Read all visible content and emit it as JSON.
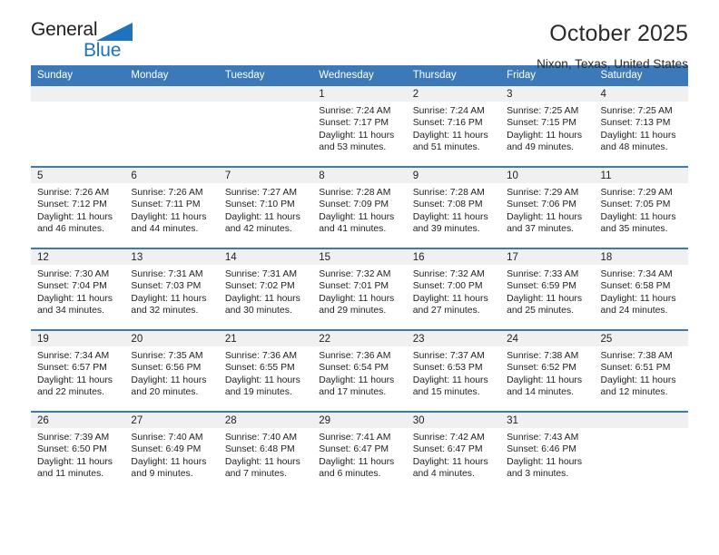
{
  "brand": {
    "name_part1": "General",
    "name_part2": "Blue",
    "accent_color": "#1f72bd"
  },
  "header": {
    "title": "October 2025",
    "subtitle": "Nixon, Texas, United States"
  },
  "calendar": {
    "header_bg": "#3b79b8",
    "daynum_bg": "#f0f0f0",
    "weekdays": [
      "Sunday",
      "Monday",
      "Tuesday",
      "Wednesday",
      "Thursday",
      "Friday",
      "Saturday"
    ],
    "leading_blanks": 3,
    "days": [
      {
        "day": "1",
        "sunrise": "Sunrise: 7:24 AM",
        "sunset": "Sunset: 7:17 PM",
        "daylight1": "Daylight: 11 hours",
        "daylight2": "and 53 minutes."
      },
      {
        "day": "2",
        "sunrise": "Sunrise: 7:24 AM",
        "sunset": "Sunset: 7:16 PM",
        "daylight1": "Daylight: 11 hours",
        "daylight2": "and 51 minutes."
      },
      {
        "day": "3",
        "sunrise": "Sunrise: 7:25 AM",
        "sunset": "Sunset: 7:15 PM",
        "daylight1": "Daylight: 11 hours",
        "daylight2": "and 49 minutes."
      },
      {
        "day": "4",
        "sunrise": "Sunrise: 7:25 AM",
        "sunset": "Sunset: 7:13 PM",
        "daylight1": "Daylight: 11 hours",
        "daylight2": "and 48 minutes."
      },
      {
        "day": "5",
        "sunrise": "Sunrise: 7:26 AM",
        "sunset": "Sunset: 7:12 PM",
        "daylight1": "Daylight: 11 hours",
        "daylight2": "and 46 minutes."
      },
      {
        "day": "6",
        "sunrise": "Sunrise: 7:26 AM",
        "sunset": "Sunset: 7:11 PM",
        "daylight1": "Daylight: 11 hours",
        "daylight2": "and 44 minutes."
      },
      {
        "day": "7",
        "sunrise": "Sunrise: 7:27 AM",
        "sunset": "Sunset: 7:10 PM",
        "daylight1": "Daylight: 11 hours",
        "daylight2": "and 42 minutes."
      },
      {
        "day": "8",
        "sunrise": "Sunrise: 7:28 AM",
        "sunset": "Sunset: 7:09 PM",
        "daylight1": "Daylight: 11 hours",
        "daylight2": "and 41 minutes."
      },
      {
        "day": "9",
        "sunrise": "Sunrise: 7:28 AM",
        "sunset": "Sunset: 7:08 PM",
        "daylight1": "Daylight: 11 hours",
        "daylight2": "and 39 minutes."
      },
      {
        "day": "10",
        "sunrise": "Sunrise: 7:29 AM",
        "sunset": "Sunset: 7:06 PM",
        "daylight1": "Daylight: 11 hours",
        "daylight2": "and 37 minutes."
      },
      {
        "day": "11",
        "sunrise": "Sunrise: 7:29 AM",
        "sunset": "Sunset: 7:05 PM",
        "daylight1": "Daylight: 11 hours",
        "daylight2": "and 35 minutes."
      },
      {
        "day": "12",
        "sunrise": "Sunrise: 7:30 AM",
        "sunset": "Sunset: 7:04 PM",
        "daylight1": "Daylight: 11 hours",
        "daylight2": "and 34 minutes."
      },
      {
        "day": "13",
        "sunrise": "Sunrise: 7:31 AM",
        "sunset": "Sunset: 7:03 PM",
        "daylight1": "Daylight: 11 hours",
        "daylight2": "and 32 minutes."
      },
      {
        "day": "14",
        "sunrise": "Sunrise: 7:31 AM",
        "sunset": "Sunset: 7:02 PM",
        "daylight1": "Daylight: 11 hours",
        "daylight2": "and 30 minutes."
      },
      {
        "day": "15",
        "sunrise": "Sunrise: 7:32 AM",
        "sunset": "Sunset: 7:01 PM",
        "daylight1": "Daylight: 11 hours",
        "daylight2": "and 29 minutes."
      },
      {
        "day": "16",
        "sunrise": "Sunrise: 7:32 AM",
        "sunset": "Sunset: 7:00 PM",
        "daylight1": "Daylight: 11 hours",
        "daylight2": "and 27 minutes."
      },
      {
        "day": "17",
        "sunrise": "Sunrise: 7:33 AM",
        "sunset": "Sunset: 6:59 PM",
        "daylight1": "Daylight: 11 hours",
        "daylight2": "and 25 minutes."
      },
      {
        "day": "18",
        "sunrise": "Sunrise: 7:34 AM",
        "sunset": "Sunset: 6:58 PM",
        "daylight1": "Daylight: 11 hours",
        "daylight2": "and 24 minutes."
      },
      {
        "day": "19",
        "sunrise": "Sunrise: 7:34 AM",
        "sunset": "Sunset: 6:57 PM",
        "daylight1": "Daylight: 11 hours",
        "daylight2": "and 22 minutes."
      },
      {
        "day": "20",
        "sunrise": "Sunrise: 7:35 AM",
        "sunset": "Sunset: 6:56 PM",
        "daylight1": "Daylight: 11 hours",
        "daylight2": "and 20 minutes."
      },
      {
        "day": "21",
        "sunrise": "Sunrise: 7:36 AM",
        "sunset": "Sunset: 6:55 PM",
        "daylight1": "Daylight: 11 hours",
        "daylight2": "and 19 minutes."
      },
      {
        "day": "22",
        "sunrise": "Sunrise: 7:36 AM",
        "sunset": "Sunset: 6:54 PM",
        "daylight1": "Daylight: 11 hours",
        "daylight2": "and 17 minutes."
      },
      {
        "day": "23",
        "sunrise": "Sunrise: 7:37 AM",
        "sunset": "Sunset: 6:53 PM",
        "daylight1": "Daylight: 11 hours",
        "daylight2": "and 15 minutes."
      },
      {
        "day": "24",
        "sunrise": "Sunrise: 7:38 AM",
        "sunset": "Sunset: 6:52 PM",
        "daylight1": "Daylight: 11 hours",
        "daylight2": "and 14 minutes."
      },
      {
        "day": "25",
        "sunrise": "Sunrise: 7:38 AM",
        "sunset": "Sunset: 6:51 PM",
        "daylight1": "Daylight: 11 hours",
        "daylight2": "and 12 minutes."
      },
      {
        "day": "26",
        "sunrise": "Sunrise: 7:39 AM",
        "sunset": "Sunset: 6:50 PM",
        "daylight1": "Daylight: 11 hours",
        "daylight2": "and 11 minutes."
      },
      {
        "day": "27",
        "sunrise": "Sunrise: 7:40 AM",
        "sunset": "Sunset: 6:49 PM",
        "daylight1": "Daylight: 11 hours",
        "daylight2": "and 9 minutes."
      },
      {
        "day": "28",
        "sunrise": "Sunrise: 7:40 AM",
        "sunset": "Sunset: 6:48 PM",
        "daylight1": "Daylight: 11 hours",
        "daylight2": "and 7 minutes."
      },
      {
        "day": "29",
        "sunrise": "Sunrise: 7:41 AM",
        "sunset": "Sunset: 6:47 PM",
        "daylight1": "Daylight: 11 hours",
        "daylight2": "and 6 minutes."
      },
      {
        "day": "30",
        "sunrise": "Sunrise: 7:42 AM",
        "sunset": "Sunset: 6:47 PM",
        "daylight1": "Daylight: 11 hours",
        "daylight2": "and 4 minutes."
      },
      {
        "day": "31",
        "sunrise": "Sunrise: 7:43 AM",
        "sunset": "Sunset: 6:46 PM",
        "daylight1": "Daylight: 11 hours",
        "daylight2": "and 3 minutes."
      }
    ]
  }
}
